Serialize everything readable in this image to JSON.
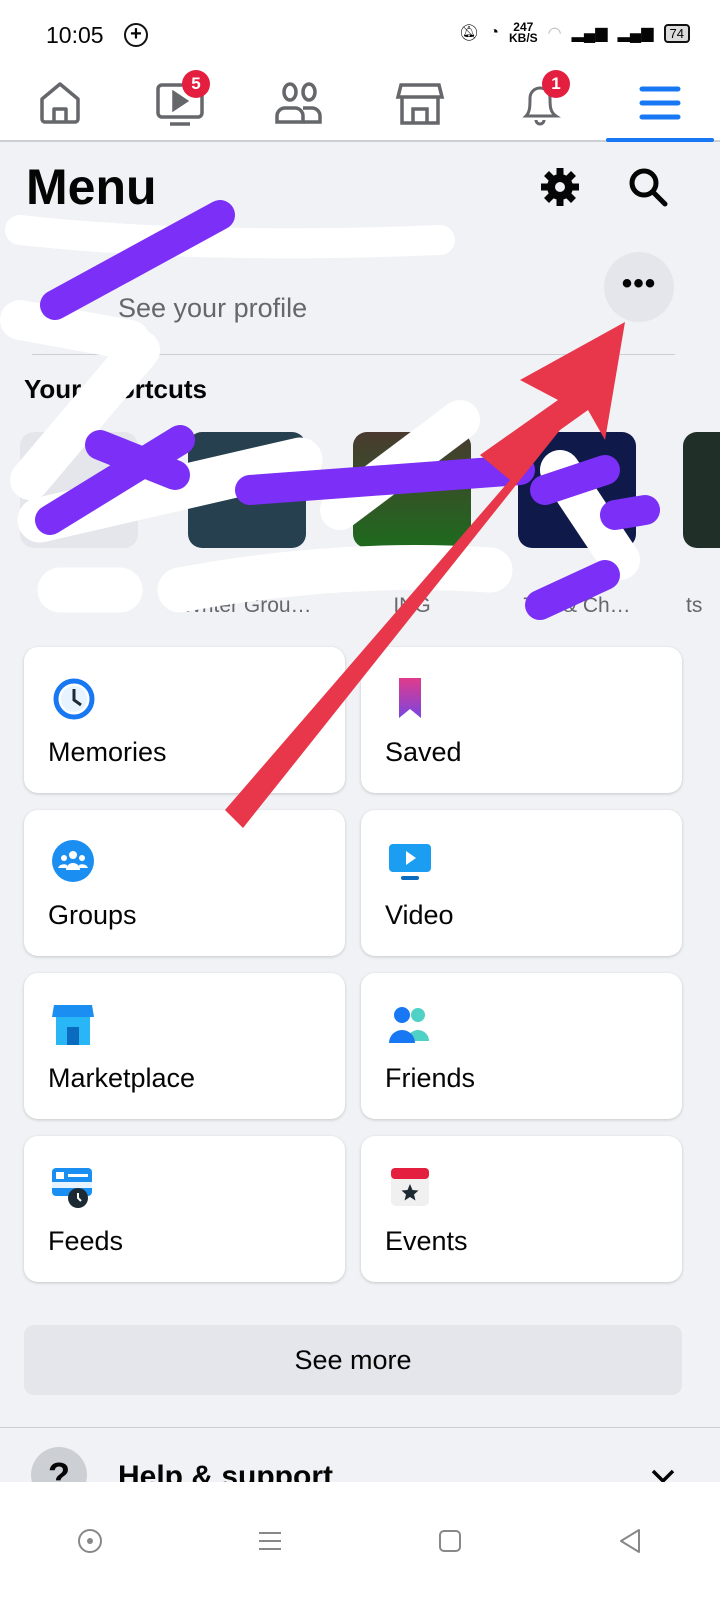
{
  "status_bar": {
    "time": "10:05",
    "net_speed": "247",
    "net_unit": "KB/S",
    "battery": "74"
  },
  "nav": {
    "tabs": [
      {
        "name": "home"
      },
      {
        "name": "video",
        "badge": "5"
      },
      {
        "name": "friends"
      },
      {
        "name": "marketplace"
      },
      {
        "name": "notifications",
        "badge": "1"
      },
      {
        "name": "menu",
        "active": true
      }
    ]
  },
  "header": {
    "title": "Menu"
  },
  "profile": {
    "subtitle": "See your profile"
  },
  "shortcuts": {
    "title": "Your shortcuts",
    "items": [
      {
        "label": ""
      },
      {
        "label": "Writer Grou…"
      },
      {
        "label": "ING"
      },
      {
        "label": "T… & Ch…"
      },
      {
        "label": "ts"
      }
    ]
  },
  "grid": [
    {
      "label": "Memories",
      "icon": "memories-icon"
    },
    {
      "label": "Saved",
      "icon": "bookmark-icon"
    },
    {
      "label": "Groups",
      "icon": "groups-icon"
    },
    {
      "label": "Video",
      "icon": "video-icon"
    },
    {
      "label": "Marketplace",
      "icon": "marketplace-icon"
    },
    {
      "label": "Friends",
      "icon": "friends-icon"
    },
    {
      "label": "Feeds",
      "icon": "feeds-icon"
    },
    {
      "label": "Events",
      "icon": "events-icon"
    }
  ],
  "see_more": "See more",
  "help": {
    "label": "Help & support"
  },
  "colors": {
    "accent": "#1877f2",
    "badge": "#e41e3f",
    "annotation_arrow": "#e8364a",
    "annotation_scribble": "#7b2ff7"
  }
}
